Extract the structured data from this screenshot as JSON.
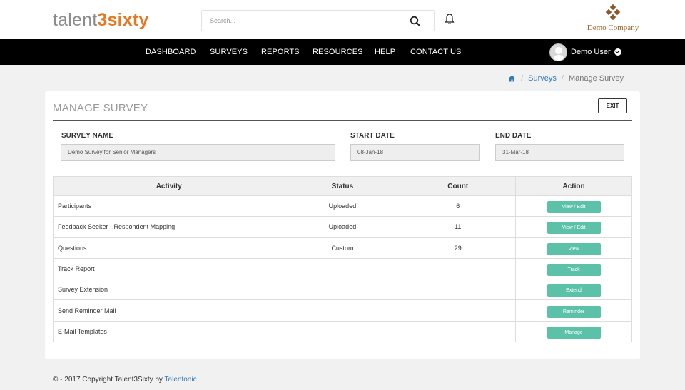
{
  "header": {
    "logo_part1": "talent",
    "logo_part2": "3sixty",
    "search": {
      "placeholder": "Search..."
    },
    "company_name": "Demo Company"
  },
  "nav": {
    "items": [
      "DASHBOARD",
      "SURVEYS",
      "REPORTS",
      "RESOURCES",
      "HELP",
      "CONTACT US"
    ],
    "user_name": "Demo User"
  },
  "breadcrumb": {
    "link": "Surveys",
    "current": "Manage Survey"
  },
  "panel": {
    "title": "MANAGE SURVEY",
    "exit_label": "EXIT",
    "fields": {
      "survey_name_label": "SURVEY NAME",
      "survey_name_value": "Demo Survey for Senior Managers",
      "start_date_label": "START DATE",
      "start_date_value": "08-Jan-18",
      "end_date_label": "END DATE",
      "end_date_value": "31-Mar-18"
    },
    "table": {
      "headers": [
        "Activity",
        "Status",
        "Count",
        "Action"
      ],
      "rows": [
        {
          "activity": "Participants",
          "status": "Uploaded",
          "count": "6",
          "action": "View / Edit"
        },
        {
          "activity": "Feedback Seeker - Respondent Mapping",
          "status": "Uploaded",
          "count": "11",
          "action": "View / Edit"
        },
        {
          "activity": "Questions",
          "status": "Custom",
          "count": "29",
          "action": "View"
        },
        {
          "activity": "Track Report",
          "status": "",
          "count": "",
          "action": "Track"
        },
        {
          "activity": "Survey Extension",
          "status": "",
          "count": "",
          "action": "Extend"
        },
        {
          "activity": "Send Reminder Mail",
          "status": "",
          "count": "",
          "action": "Reminder"
        },
        {
          "activity": "E-Mail Templates",
          "status": "",
          "count": "",
          "action": "Manage"
        }
      ]
    }
  },
  "footer": {
    "text": "© - 2017 Copyright Talent3Sixty by",
    "link": "Talentonic"
  },
  "colors": {
    "accent_button": "#5bc2a9",
    "logo_orange": "#e87722",
    "company_brown": "#a0662a",
    "nav_bg": "#000000",
    "link": "#337ab7"
  },
  "icons": [
    "search-icon",
    "bell-icon",
    "company-logo-icon",
    "user-avatar-icon",
    "chevron-down-icon",
    "home-icon"
  ]
}
